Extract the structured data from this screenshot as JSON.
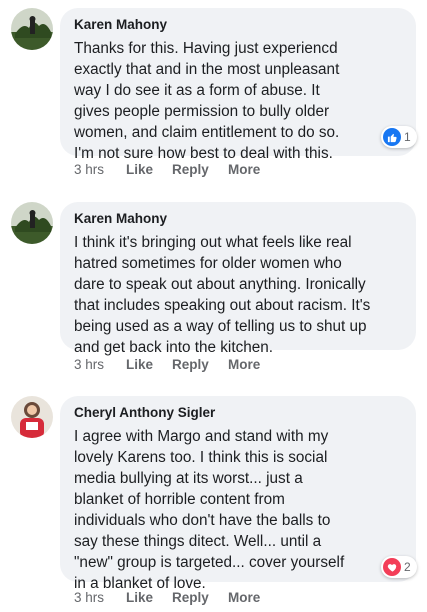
{
  "comments": [
    {
      "author": "Karen Mahony",
      "text": "Thanks for this. Having just experiencd\nexactly that and in the most unpleasant\nway I do see it as a form of abuse. It\ngives people permission to bully older\nwomen, and claim entitlement to do so.\nI'm not sure how best to deal with this.",
      "time": "3 hrs",
      "like": "Like",
      "reply": "Reply",
      "more": "More",
      "reaction": {
        "icon": "thumbs-up-icon",
        "color": "#1877f2",
        "count": "1"
      }
    },
    {
      "author": "Karen Mahony",
      "text": "I think it's bringing out what feels like real\nhatred sometimes for older women who\ndare to speak out about anything. Ironically\nthat includes speaking out about racism. It's\nbeing used as a way of telling us to shut up\nand get back into the kitchen.",
      "time": "3 hrs",
      "like": "Like",
      "reply": "Reply",
      "more": "More"
    },
    {
      "author": "Cheryl Anthony Sigler",
      "text": "I agree with Margo and stand with my\nlovely Karens too. I think this is social\nmedia bullying at its worst... just a\nblanket of horrible content from\nindividuals who don't have the balls to\nsay these things ditect. Well... until a\n\"new\" group is targeted... cover yourself\nin a blanket of love.",
      "time": "3 hrs",
      "like": "Like",
      "reply": "Reply",
      "more": "More",
      "reaction": {
        "icon": "heart-icon",
        "color": "#f33e58",
        "count": "2"
      }
    }
  ]
}
